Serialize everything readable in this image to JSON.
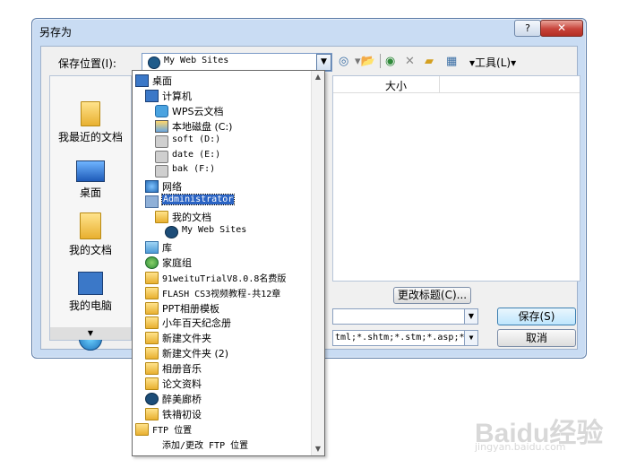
{
  "dialog": {
    "title": "另存为",
    "help_label": "?",
    "close_label": "✕",
    "save_in_label": "保存位置(I):",
    "save_in_value": "My Web Sites",
    "tools_label": "▾工具(L)▾",
    "rename_label": "更改标题(C)...",
    "save_label": "保存(S)",
    "cancel_label": "取消",
    "filetype_value": "tml;*.shtm;*.stm;*.asp;*",
    "column_size": "大小"
  },
  "places": [
    {
      "label": "我最近的文档",
      "icon": "recent-documents-icon"
    },
    {
      "label": "桌面",
      "icon": "desktop-icon"
    },
    {
      "label": "我的文档",
      "icon": "my-documents-icon"
    },
    {
      "label": "我的电脑",
      "icon": "my-computer-icon"
    },
    {
      "label": "",
      "icon": "network-places-icon"
    }
  ],
  "dropdown": {
    "items": [
      {
        "label": "桌面",
        "icon": "desktop-icon",
        "indent": 0
      },
      {
        "label": "计算机",
        "icon": "computer-icon",
        "indent": 1
      },
      {
        "label": "WPS云文档",
        "icon": "wps-cloud-icon",
        "indent": 2
      },
      {
        "label": "本地磁盘 (C:)",
        "icon": "system-drive-icon",
        "indent": 2
      },
      {
        "label": "soft (D:)",
        "icon": "drive-icon",
        "indent": 2
      },
      {
        "label": "date (E:)",
        "icon": "drive-icon",
        "indent": 2
      },
      {
        "label": "bak (F:)",
        "icon": "drive-icon",
        "indent": 2
      },
      {
        "label": "网络",
        "icon": "network-icon",
        "indent": 1
      },
      {
        "label": "Administrator",
        "icon": "user-icon",
        "indent": 1,
        "selected": true
      },
      {
        "label": "我的文档",
        "icon": "folder-icon",
        "indent": 2
      },
      {
        "label": "My Web Sites",
        "icon": "web-folder-icon",
        "indent": 3
      },
      {
        "label": "库",
        "icon": "library-icon",
        "indent": 1
      },
      {
        "label": "家庭组",
        "icon": "homegroup-icon",
        "indent": 1
      },
      {
        "label": "91weituTrialV8.0.8名费版",
        "icon": "folder-icon",
        "indent": 1
      },
      {
        "label": "FLASH CS3视频教程-共12章",
        "icon": "folder-icon",
        "indent": 1
      },
      {
        "label": "PPT相册模板",
        "icon": "folder-icon",
        "indent": 1
      },
      {
        "label": "小年百天纪念册",
        "icon": "folder-icon",
        "indent": 1
      },
      {
        "label": "新建文件夹",
        "icon": "folder-icon",
        "indent": 1
      },
      {
        "label": "新建文件夹 (2)",
        "icon": "folder-icon",
        "indent": 1
      },
      {
        "label": "相册音乐",
        "icon": "folder-icon",
        "indent": 1
      },
      {
        "label": "论文资料",
        "icon": "folder-icon",
        "indent": 1
      },
      {
        "label": "醉美廊桥",
        "icon": "web-folder-icon",
        "indent": 1
      },
      {
        "label": "铁褙初设",
        "icon": "folder-icon",
        "indent": 1
      },
      {
        "label": "FTP 位置",
        "icon": "folder-icon",
        "indent": 0
      },
      {
        "label": "添加/更改 FTP 位置",
        "icon": "",
        "indent": 1
      }
    ]
  },
  "watermark": {
    "logo": "Baidu经验",
    "url": "jingyan.baidu.com"
  }
}
